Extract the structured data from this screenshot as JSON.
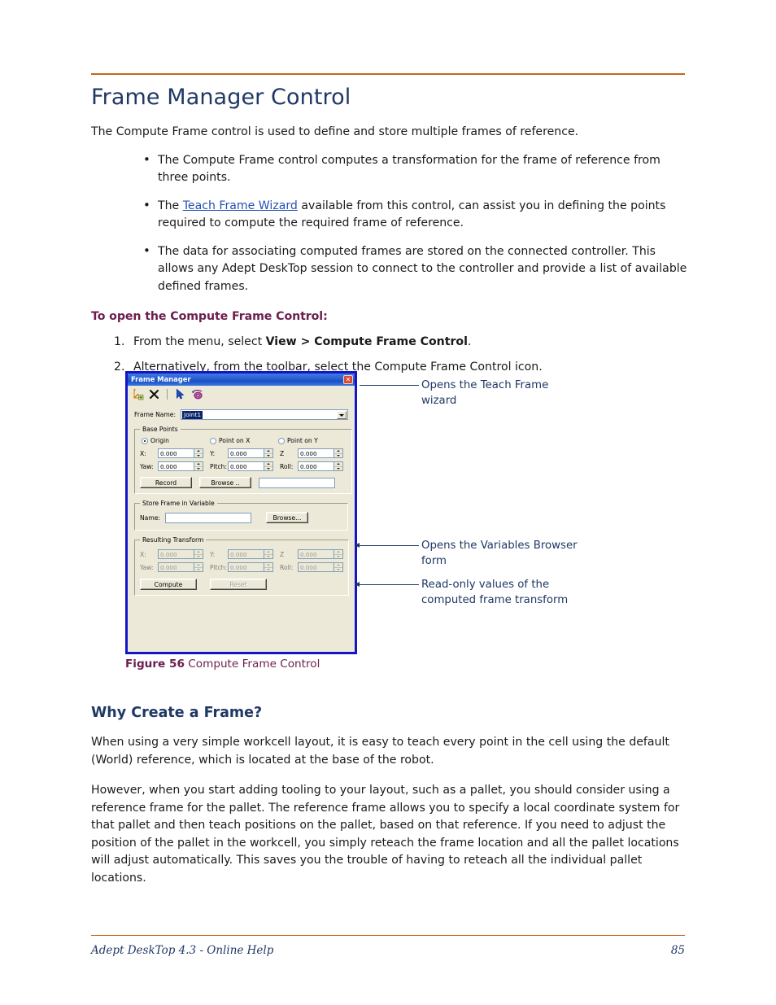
{
  "document": {
    "title": "Frame Manager Control",
    "intro": "The Compute Frame control is used to define and store multiple frames of reference.",
    "bullets": [
      {
        "before": "The Compute Frame control computes a transformation for the frame of reference from three points.",
        "link": "",
        "after": ""
      },
      {
        "before": "The ",
        "link": "Teach Frame Wizard",
        "after": " available from this control, can assist you in defining the points required to compute the required frame of reference."
      },
      {
        "before": "The data for associating computed frames are stored on the connected controller. This allows any Adept DeskTop session to connect to the controller and provide a list of available defined frames.",
        "link": "",
        "after": ""
      }
    ],
    "procedure_heading": "To open the Compute Frame Control:",
    "steps": [
      {
        "before": "From the menu, select ",
        "bold": "View > Compute Frame Control",
        "after": "."
      },
      {
        "before": "Alternatively, from the toolbar, select the Compute Frame Control icon.",
        "bold": "",
        "after": ""
      }
    ],
    "figure": {
      "caption_label": "Figure 56",
      "caption_text": "Compute Frame  Control"
    },
    "section_heading": "Why Create a Frame?",
    "paragraphs": [
      "When using a very simple workcell layout, it is easy to teach every point in the cell using the default (World) reference, which is located at the base of the robot.",
      "However, when you start adding tooling to your layout, such as a pallet, you should consider using a reference frame for the pallet. The reference frame allows you to specify a local coordinate system for that pallet and then teach positions on the pallet, based on that reference. If you need to adjust the position of the pallet in the workcell, you simply reteach the frame location and all the pallet locations will adjust automatically. This saves you the trouble of having to reteach all the individual pallet locations."
    ]
  },
  "callouts": [
    {
      "text": "Opens the Teach Frame\nwizard"
    },
    {
      "text": "Opens the Variables Browser\nform"
    },
    {
      "text": "Read-only values of the\ncomputed frame transform"
    }
  ],
  "dialog": {
    "title": "Frame Manager",
    "close_label": "✕",
    "toolbar_icons": [
      "new-frame-axes-icon",
      "delete-frame-x-icon",
      "pointer-select-icon",
      "teach-frame-wizard-icon"
    ],
    "frame_name_label": "Frame Name:",
    "frame_name_value": "Joint1",
    "base_points": {
      "legend": "Base Points",
      "radios": [
        {
          "label": "Origin",
          "selected": true
        },
        {
          "label": "Point on X",
          "selected": false
        },
        {
          "label": "Point on Y",
          "selected": false
        }
      ],
      "fields": [
        {
          "label": "X:",
          "value": "0.000"
        },
        {
          "label": "Y:",
          "value": "0.000"
        },
        {
          "label": "Z",
          "value": "0.000"
        },
        {
          "label": "Yaw:",
          "value": "0.000"
        },
        {
          "label": "Pitch:",
          "value": "0.000"
        },
        {
          "label": "Roll:",
          "value": "0.000"
        }
      ],
      "record_button": "Record",
      "browse_button": "Browse ..",
      "text_value": ""
    },
    "store_frame": {
      "legend": "Store Frame in Variable",
      "name_label": "Name:",
      "name_value": "",
      "browse_button": "Browse..."
    },
    "resulting_transform": {
      "legend": "Resulting Transform",
      "fields": [
        {
          "label": "X:",
          "value": "0.000"
        },
        {
          "label": "Y:",
          "value": "0.000"
        },
        {
          "label": "Z",
          "value": "0.000"
        },
        {
          "label": "Yaw:",
          "value": "0.000"
        },
        {
          "label": "Pitch:",
          "value": "0.000"
        },
        {
          "label": "Roll:",
          "value": "0.000"
        }
      ],
      "compute_button": "Compute",
      "reset_button": "Reset"
    }
  },
  "footer": {
    "left": "Adept DeskTop 4.3  - Online Help",
    "page": "85"
  },
  "colors": {
    "rule": "#c8641e",
    "heading": "#1f3864",
    "subhead": "#6b1f4e",
    "link": "#2451b5",
    "callout": "#1f3864",
    "dialog_border": "#1515c8",
    "dialog_face": "#ece9d8"
  }
}
